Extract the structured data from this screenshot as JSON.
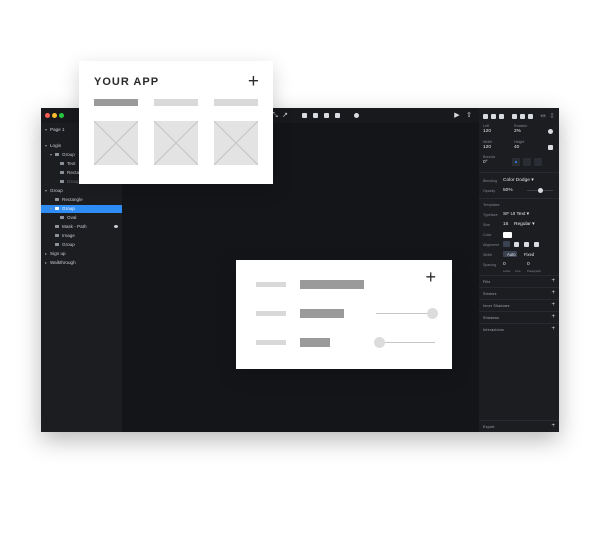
{
  "layers": {
    "items": [
      {
        "label": "Page 1",
        "indent": 0,
        "caret": "▾",
        "selected": false,
        "dim": false
      },
      {
        "label": "Login",
        "indent": 0,
        "caret": "▾",
        "selected": false,
        "dim": false
      },
      {
        "label": "Group",
        "indent": 1,
        "caret": "▾",
        "selected": false,
        "dim": false
      },
      {
        "label": "Text",
        "indent": 2,
        "caret": "",
        "selected": false,
        "dim": false
      },
      {
        "label": "Rectangle",
        "indent": 2,
        "caret": "",
        "selected": false,
        "dim": false
      },
      {
        "label": "Group",
        "indent": 2,
        "caret": "",
        "selected": false,
        "dim": true
      },
      {
        "label": "Group",
        "indent": 0,
        "caret": "▾",
        "selected": false,
        "dim": false
      },
      {
        "label": "Rectangle",
        "indent": 1,
        "caret": "",
        "selected": false,
        "dim": false
      },
      {
        "label": "Group",
        "indent": 1,
        "caret": "▾",
        "selected": true,
        "dim": false
      },
      {
        "label": "Oval",
        "indent": 2,
        "caret": "",
        "selected": false,
        "dim": false
      },
      {
        "label": "Mask - Path",
        "indent": 1,
        "caret": "",
        "selected": false,
        "dim": false
      },
      {
        "label": "Image",
        "indent": 1,
        "caret": "",
        "selected": false,
        "dim": false
      },
      {
        "label": "Group",
        "indent": 1,
        "caret": "",
        "selected": false,
        "dim": false
      },
      {
        "label": "Sign up",
        "indent": 0,
        "caret": "▸",
        "selected": false,
        "dim": false
      },
      {
        "label": "Walkthrough",
        "indent": 0,
        "caret": "▸",
        "selected": false,
        "dim": false
      }
    ]
  },
  "inspector": {
    "left_label": "Left",
    "left_value": "120",
    "rotation_label": "Rotation",
    "rotation_value": "2%",
    "width_label": "Width",
    "width_value": "120",
    "height_label": "Height",
    "height_value": "40",
    "bounds_label": "Bounds",
    "bounds_value": "0°",
    "blending_label": "Blending",
    "blending_value": "Color Dodge ▾",
    "opacity_label": "Opacity",
    "opacity_value": "50%",
    "opacity_level": 0.5,
    "templates_label": "Templates",
    "typeface_label": "Typeface",
    "typeface_value": "SF UI Text ▾",
    "size_label": "Size",
    "size_value": "16",
    "weight_value": "Regular ▾",
    "color_label": "Color",
    "alignment_label": "Alignment",
    "width2_label": "Width",
    "auto_value": "Auto",
    "fixed_value": "Fixed",
    "spacing_label": "Spacing",
    "line_value": "0",
    "para_value": "0",
    "spacing_sub1": "Letter",
    "spacing_sub2": "Line",
    "spacing_sub3": "Paragraph",
    "sections": [
      "Fills",
      "Strokes",
      "Inner Shadows",
      "Shadows",
      "Interactions"
    ],
    "export_label": "Export",
    "plus": "+"
  },
  "app_card": {
    "title": "YOUR APP",
    "plus": "+"
  },
  "form_card": {
    "plus": "+",
    "rows": [
      {
        "value_fill": 1.0
      },
      {
        "slider_level": 1.0
      },
      {
        "slider_level": 0.0
      }
    ]
  },
  "colors": {
    "window_bg": "#131519",
    "panel_bg": "#1b1d21",
    "selection": "#2f8cf5",
    "placeholder_dark": "#9a9a9a",
    "placeholder_light": "#d9d9d9"
  }
}
